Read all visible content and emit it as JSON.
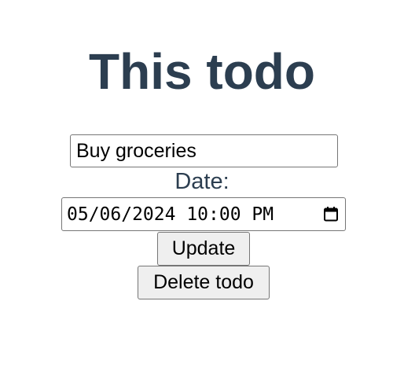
{
  "page": {
    "title": "This todo"
  },
  "form": {
    "name_value": "Buy groceries",
    "date_label": "Date:",
    "date_value": "05/06/2024 10:00 PM",
    "update_label": "Update",
    "delete_label": "Delete todo"
  },
  "icons": {
    "calendar": "calendar-icon"
  }
}
